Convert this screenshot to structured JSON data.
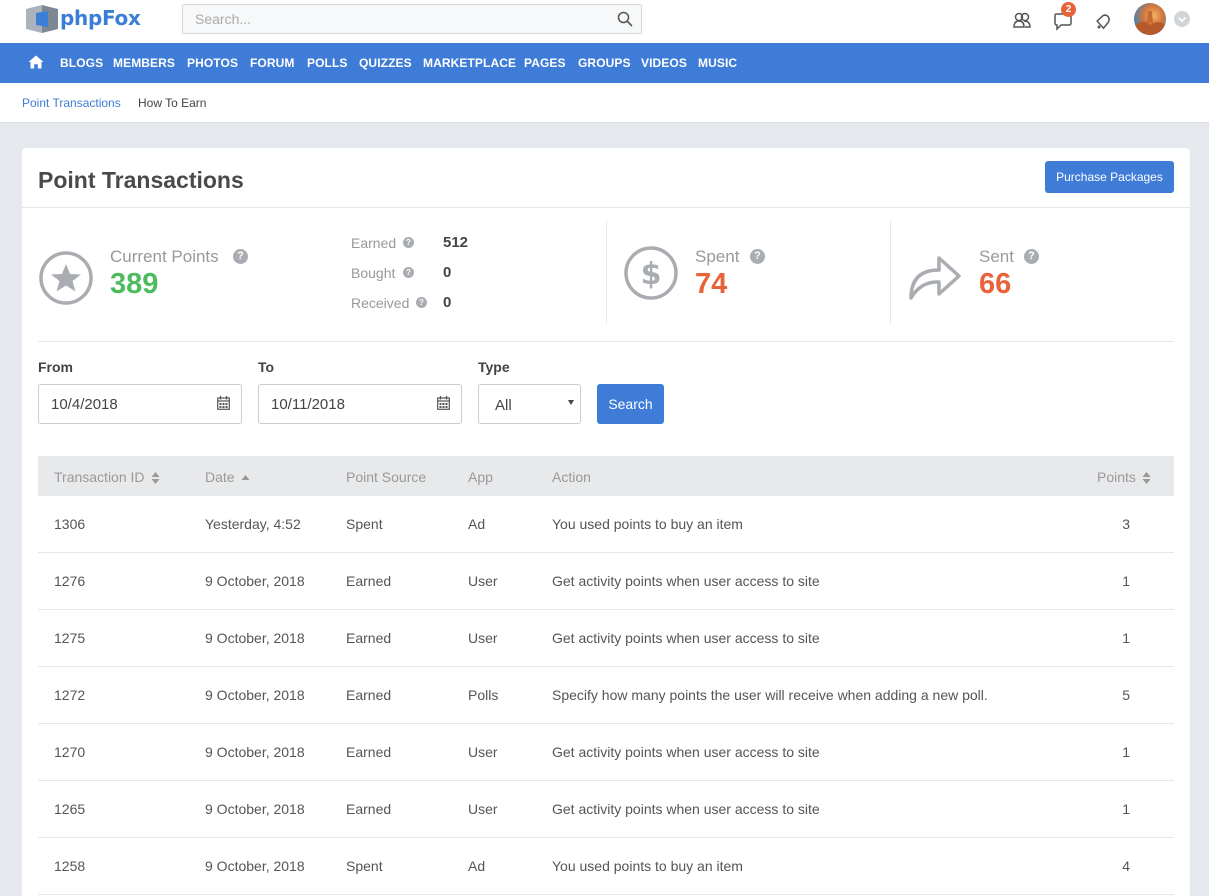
{
  "app": {
    "name": "phpFox"
  },
  "search": {
    "placeholder": "Search..."
  },
  "notifications": {
    "messages_count": "2"
  },
  "nav": {
    "items": [
      "BLOGS",
      "MEMBERS",
      "PHOTOS",
      "FORUM",
      "POLLS",
      "QUIZZES",
      "MARKETPLACE",
      "PAGES",
      "GROUPS",
      "VIDEOS",
      "MUSIC"
    ]
  },
  "breadcrumb": {
    "items": [
      "Point Transactions",
      "How To Earn"
    ]
  },
  "page": {
    "title": "Point Transactions",
    "purchase_label": "Purchase Packages"
  },
  "stats": {
    "current": {
      "label": "Current Points",
      "value": "389"
    },
    "earned": {
      "label": "Earned",
      "value": "512"
    },
    "bought": {
      "label": "Bought",
      "value": "0"
    },
    "received": {
      "label": "Received",
      "value": "0"
    },
    "spent": {
      "label": "Spent",
      "value": "74"
    },
    "sent": {
      "label": "Sent",
      "value": "66"
    },
    "colors": {
      "current": "#4cbc5f",
      "spent": "#e8623a",
      "sent": "#e8623a"
    }
  },
  "filters": {
    "from_label": "From",
    "from_value": "10/4/2018",
    "to_label": "To",
    "to_value": "10/11/2018",
    "type_label": "Type",
    "type_value": "All",
    "search_label": "Search"
  },
  "table": {
    "headers": [
      "Transaction ID",
      "Date",
      "Point Source",
      "App",
      "Action",
      "Points"
    ],
    "rows": [
      {
        "id": "1306",
        "date": "Yesterday, 4:52",
        "source": "Spent",
        "app": "Ad",
        "action": "You used points to buy an item",
        "points": "3"
      },
      {
        "id": "1276",
        "date": "9 October, 2018",
        "source": "Earned",
        "app": "User",
        "action": "Get activity points when user access to site",
        "points": "1"
      },
      {
        "id": "1275",
        "date": "9 October, 2018",
        "source": "Earned",
        "app": "User",
        "action": "Get activity points when user access to site",
        "points": "1"
      },
      {
        "id": "1272",
        "date": "9 October, 2018",
        "source": "Earned",
        "app": "Polls",
        "action": "Specify how many points the user will receive when adding a new poll.",
        "points": "5"
      },
      {
        "id": "1270",
        "date": "9 October, 2018",
        "source": "Earned",
        "app": "User",
        "action": "Get activity points when user access to site",
        "points": "1"
      },
      {
        "id": "1265",
        "date": "9 October, 2018",
        "source": "Earned",
        "app": "User",
        "action": "Get activity points when user access to site",
        "points": "1"
      },
      {
        "id": "1258",
        "date": "9 October, 2018",
        "source": "Spent",
        "app": "Ad",
        "action": "You used points to buy an item",
        "points": "4"
      }
    ]
  },
  "colors": {
    "accent": "#3f7cd7",
    "nav_bg": "#3f7cd7",
    "badge": "#e8623a"
  }
}
